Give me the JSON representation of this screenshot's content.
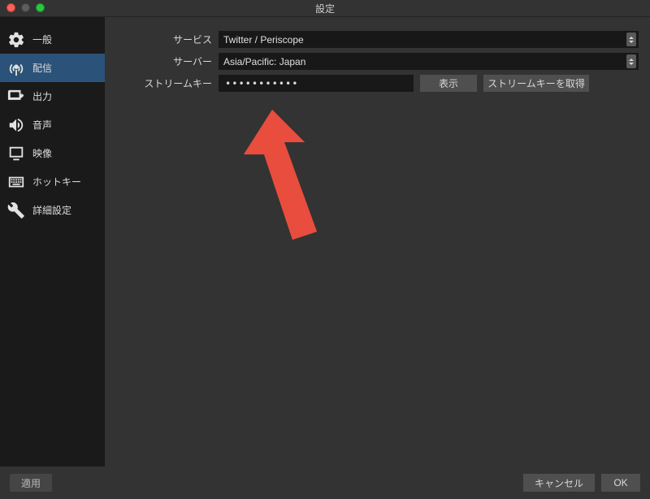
{
  "window": {
    "title": "設定"
  },
  "sidebar": {
    "items": [
      {
        "label": "一般"
      },
      {
        "label": "配信"
      },
      {
        "label": "出力"
      },
      {
        "label": "音声"
      },
      {
        "label": "映像"
      },
      {
        "label": "ホットキー"
      },
      {
        "label": "詳細設定"
      }
    ]
  },
  "main": {
    "service_label": "サービス",
    "service_value": "Twitter / Periscope",
    "server_label": "サーバー",
    "server_value": "Asia/Pacific: Japan",
    "streamkey_label": "ストリームキー",
    "streamkey_masked": "•••••••••••",
    "show_button": "表示",
    "getkey_button": "ストリームキーを取得"
  },
  "footer": {
    "apply": "適用",
    "cancel": "キャンセル",
    "ok": "OK"
  },
  "colors": {
    "accent": "#2b5278",
    "arrow": "#e84d3d"
  }
}
